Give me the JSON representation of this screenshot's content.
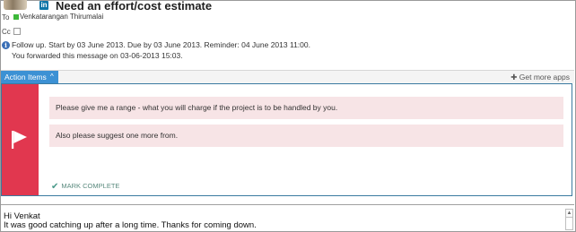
{
  "message": {
    "subject": "Need an effort/cost estimate",
    "to_label": "To",
    "recipient": "Venkatarangan Thirumalai",
    "cc_label": "Cc",
    "linkedin_badge": "in",
    "info_line1": "Follow up.  Start by 03 June 2013.  Due by 03 June 2013.  Reminder: 04 June 2013 11:00.",
    "info_line2": "You forwarded this message on 03-06-2013 15:03."
  },
  "apps_bar": {
    "tab_label": "Action Items",
    "tab_chevron": "^",
    "more_apps": "Get more apps"
  },
  "action_card": {
    "items": [
      "Please give me a range - what you will charge if the project is to be handled by you.",
      "Also please suggest one more  from."
    ],
    "mark_complete": "MARK COMPLETE"
  },
  "body": {
    "greeting": "Hi Venkat",
    "line1": "It was good catching up after a long time. Thanks for coming down."
  },
  "colors": {
    "accent_red": "#e1374f",
    "tab_blue": "#3c91d4",
    "item_bg": "#f7e4e6",
    "presence_green": "#3db83a"
  },
  "icons": [
    "avatar",
    "linkedin-icon",
    "presence-icon",
    "info-icon",
    "chevron-up-icon",
    "plus-icon",
    "flag-icon",
    "checkmark-icon"
  ]
}
